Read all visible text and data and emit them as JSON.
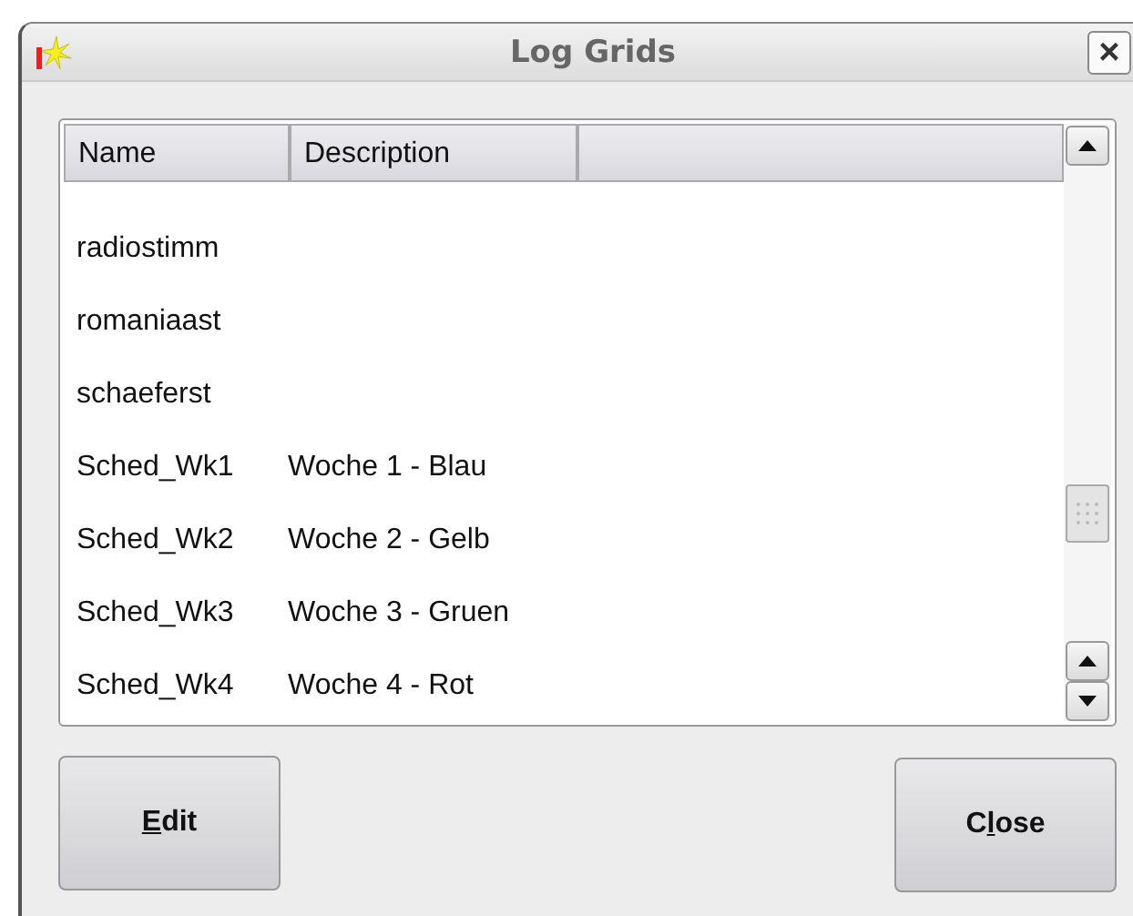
{
  "window": {
    "title": "Log Grids",
    "close_glyph": "×"
  },
  "table": {
    "columns": [
      "Name",
      "Description"
    ],
    "rows": [
      {
        "name": "radiostimm"
      },
      {
        "name": "romaniaast"
      },
      {
        "name": "schaeferst"
      },
      {
        "name": "Sched_Wk1",
        "description": "Woche 1 - Blau"
      },
      {
        "name": "Sched_Wk2",
        "description": "Woche 2 - Gelb"
      },
      {
        "name": "Sched_Wk3",
        "description": "Woche 3 - Gruen"
      },
      {
        "name": "Sched_Wk4",
        "description": "Woche 4 - Rot"
      }
    ]
  },
  "buttons": [
    {
      "kind": "edit",
      "key": "E",
      "after": "dit"
    },
    {
      "kind": "close",
      "before": "C",
      "key": "l",
      "after": "ose"
    }
  ]
}
